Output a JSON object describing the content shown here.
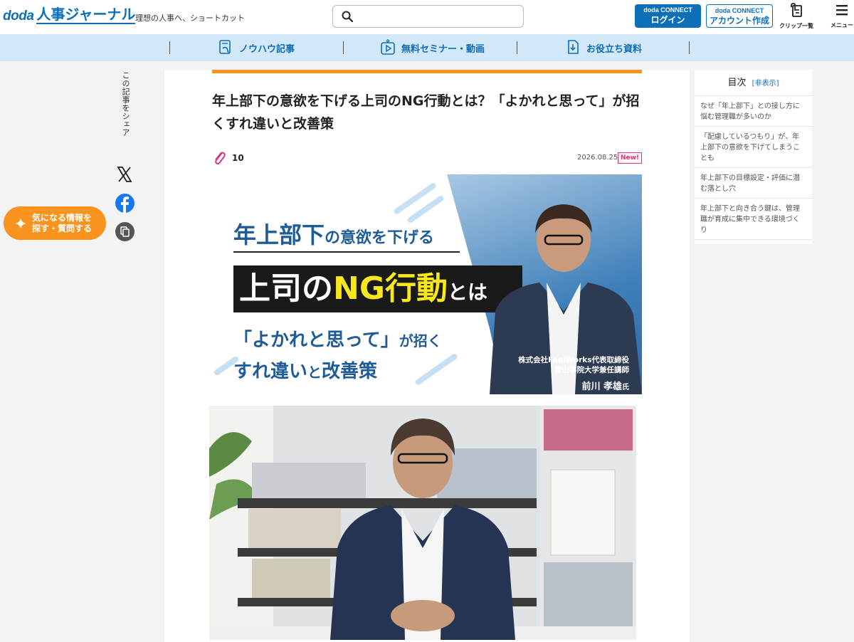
{
  "header": {
    "logo_brand": "doda",
    "logo_name": "人事ジャーナル",
    "tagline": "理想の人事へ、ショートカット",
    "search_placeholder": "",
    "login_small": "doda CONNECT",
    "login_big": "ログイン",
    "signup_small": "doda CONNECT",
    "signup_big": "アカウント作成",
    "clip_label": "クリップ一覧",
    "menu_label": "メニュー"
  },
  "nav": {
    "items": [
      {
        "label": "ノウハウ記事",
        "icon": "document-hand-icon"
      },
      {
        "label": "無料セミナー・動画",
        "icon": "video-play-icon"
      },
      {
        "label": "お役立ち資料",
        "icon": "download-doc-icon"
      }
    ]
  },
  "share": {
    "label": "この記事をシェア",
    "x_icon": "x-twitter-icon",
    "facebook_icon": "facebook-icon",
    "copy_icon": "copy-link-icon"
  },
  "floating_button": {
    "line1": "気になる情報を",
    "line2": "探す・質問する"
  },
  "article": {
    "title": "年上部下の意欲を下げる上司のNG行動とは？「よかれと思って」が招くすれ違いと改善策",
    "clip_count": "10",
    "date": "2026.08.25",
    "new_badge": "New!",
    "hero": {
      "line1_big": "年上部下",
      "line1_small": "の意欲を下げる",
      "line2_a": "上司の",
      "line2_b": "NG行動",
      "line2_c": "とは",
      "line3_big": "「よかれと思って」",
      "line3_small": "が招く",
      "line4_a": "すれ違い",
      "line4_small": "と",
      "line4_b": "改善策",
      "caption_company": "株式会社FeelWorks代表取締役",
      "caption_role": "青山学院大学兼任講師",
      "caption_name": "前川 孝雄",
      "caption_suffix": "氏"
    }
  },
  "toc": {
    "title": "目次",
    "toggle": "[非表示]",
    "items": [
      "なぜ「年上部下」との接し方に悩む管理職が多いのか",
      "「配慮しているつもり」が、年上部下の意欲を下げてしまうことも",
      "年上部下の目標設定・評価に潜む落とし穴",
      "年上部下と向き合う鍵は、管理職が育成に集中できる環境づくり"
    ]
  },
  "colors": {
    "brand_blue": "#0d6fb8",
    "accent_orange": "#f7931e",
    "new_pink": "#e8336d",
    "nav_bg": "#d2e8f8"
  }
}
